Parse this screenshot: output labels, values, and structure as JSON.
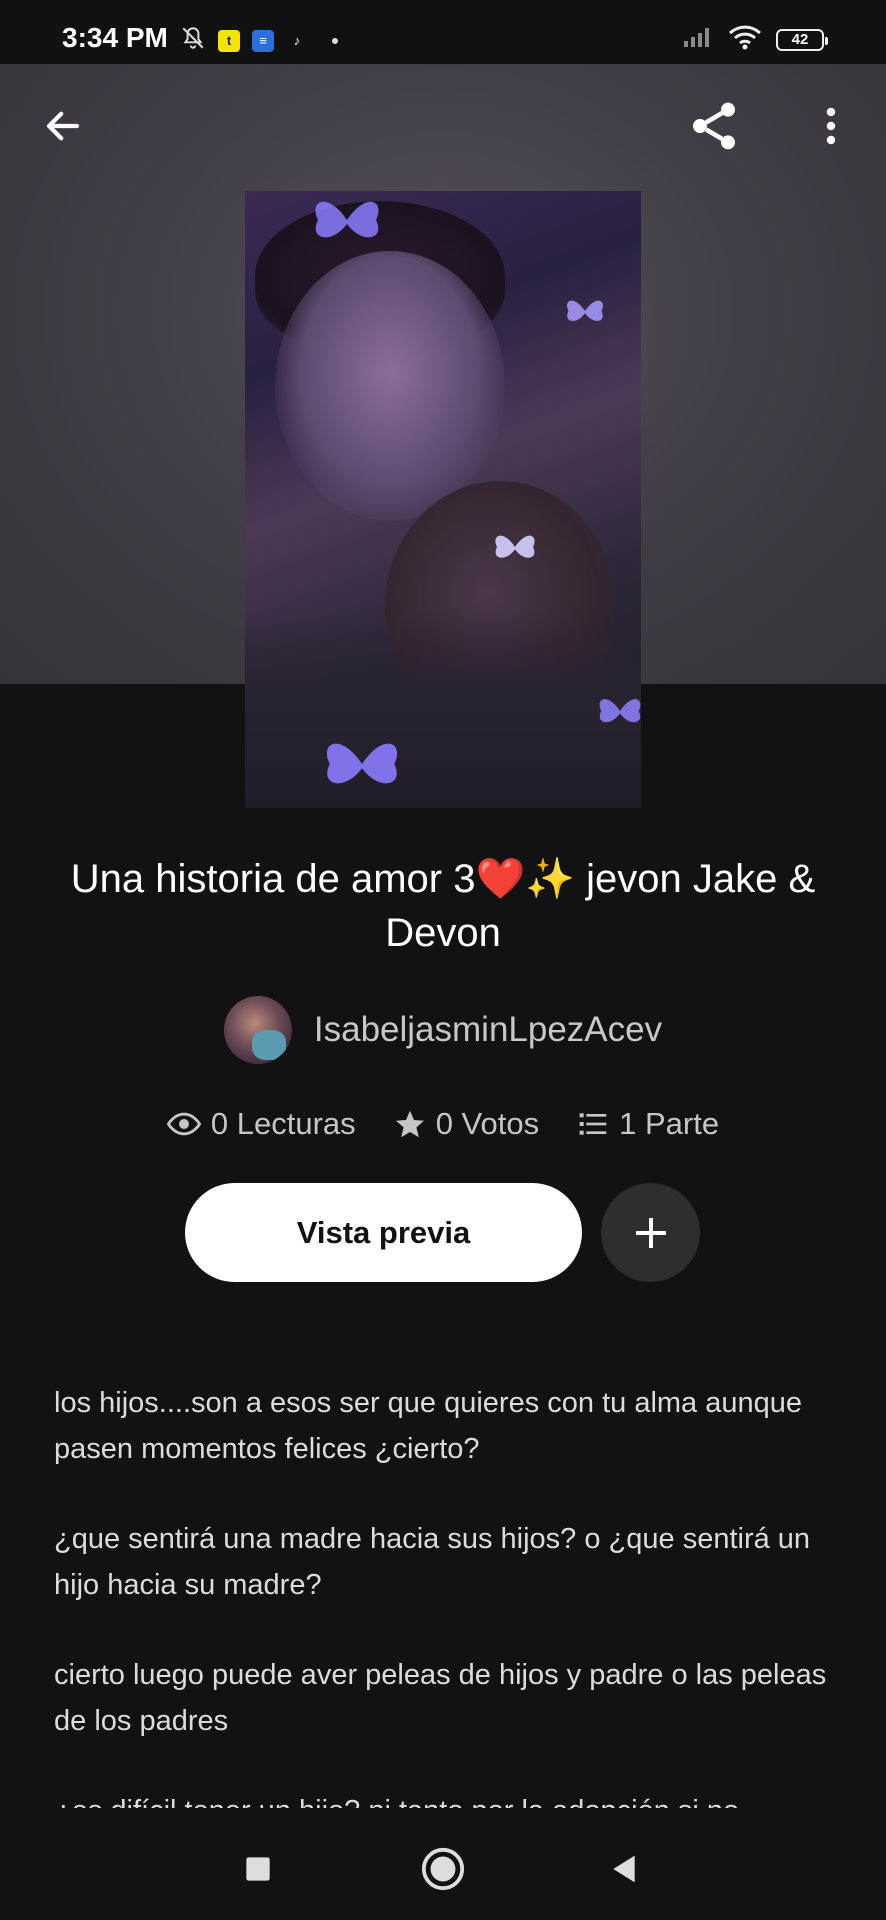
{
  "status_bar": {
    "time": "3:34 PM",
    "battery": "42",
    "icons": [
      "mute-bell-icon",
      "app-notification-icon",
      "message-icon",
      "tiktok-icon",
      "signal-icon",
      "wifi-icon",
      "battery-icon"
    ]
  },
  "header": {
    "back_icon": "arrow-left-icon",
    "share_icon": "share-icon",
    "more_icon": "more-vertical-icon"
  },
  "story": {
    "title": "Una historia de amor 3❤️✨ jevon Jake & Devon",
    "author": "IsabeljasminLpezAcev",
    "stats": {
      "reads": "0 Lecturas",
      "votes": "0 Votos",
      "parts": "1 Parte"
    },
    "preview_label": "Vista previa",
    "add_label": "+",
    "description": [
      "los hijos....son a esos ser que quieres con tu alma aunque pasen momentos felices ¿cierto?",
      "¿que sentirá una madre hacia sus hijos? o ¿que sentirá un hijo hacia su madre?",
      "cierto luego puede aver peleas de hijos y padre o las peleas de los padres",
      "¿es difícil tener un hijo? ni tanto por la adopción si no"
    ]
  },
  "colors": {
    "background": "#121212",
    "button_primary": "#ffffff",
    "button_secondary": "#2e2e2e",
    "muted_text": "#c6c6c6"
  }
}
